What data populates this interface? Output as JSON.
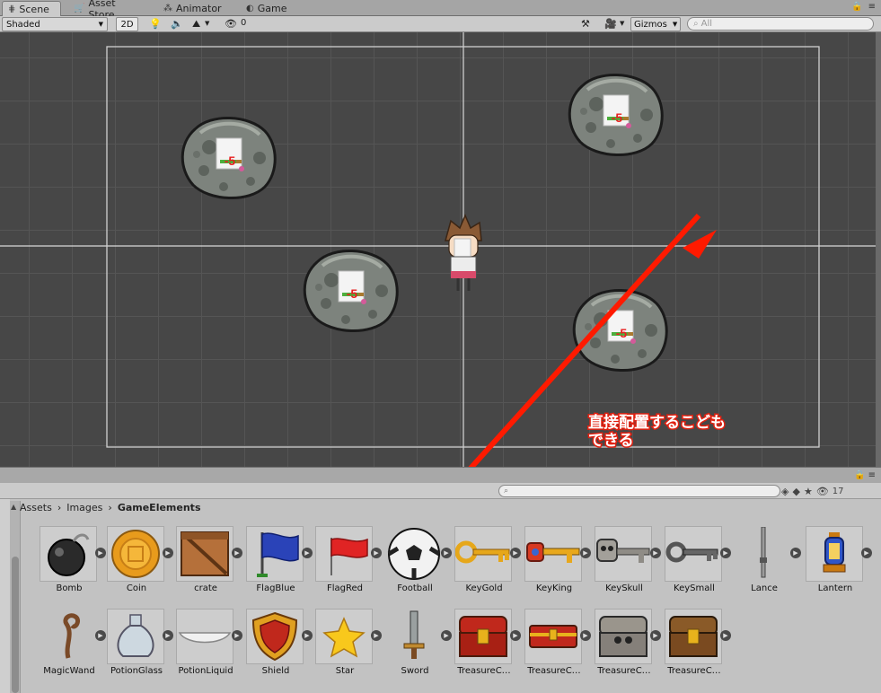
{
  "tabs": [
    {
      "label": "Scene",
      "icon": "grid-icon"
    },
    {
      "label": "Asset Store",
      "icon": "cart-icon"
    },
    {
      "label": "Animator",
      "icon": "animator-icon"
    },
    {
      "label": "Game",
      "icon": "pacman-icon"
    }
  ],
  "toolbar": {
    "shading_mode": "Shaded",
    "mode_2d": "2D",
    "hidden_count": "0",
    "gizmos": "Gizmos",
    "search_placeholder": "All"
  },
  "annotation": {
    "line1": "直接配置するこども",
    "line2": "できる",
    "arrow_color": "#ff1a00"
  },
  "project": {
    "breadcrumb": [
      "Assets",
      "Images",
      "GameElements"
    ],
    "filter_count": "17"
  },
  "assets": [
    {
      "label": "Bomb",
      "icon": "bomb-icon"
    },
    {
      "label": "Coin",
      "icon": "coin-icon"
    },
    {
      "label": "crate",
      "icon": "crate-icon"
    },
    {
      "label": "FlagBlue",
      "icon": "flag-blue-icon"
    },
    {
      "label": "FlagRed",
      "icon": "flag-red-icon"
    },
    {
      "label": "Football",
      "icon": "football-icon"
    },
    {
      "label": "KeyGold",
      "icon": "key-gold-icon"
    },
    {
      "label": "KeyKing",
      "icon": "key-king-icon"
    },
    {
      "label": "KeySkull",
      "icon": "key-skull-icon"
    },
    {
      "label": "KeySmall",
      "icon": "key-small-icon"
    },
    {
      "label": "Lance",
      "icon": "lance-icon"
    },
    {
      "label": "Lantern",
      "icon": "lantern-icon"
    },
    {
      "label": "MagicWand",
      "icon": "magic-wand-icon"
    },
    {
      "label": "PotionGlass",
      "icon": "potion-glass-icon"
    },
    {
      "label": "PotionLiquid",
      "icon": "potion-liquid-icon"
    },
    {
      "label": "Shield",
      "icon": "shield-icon"
    },
    {
      "label": "Star",
      "icon": "star-icon"
    },
    {
      "label": "Sword",
      "icon": "sword-icon"
    },
    {
      "label": "TreasureC…",
      "icon": "treasure-chest-icon"
    },
    {
      "label": "TreasureC…",
      "icon": "treasure-chest-icon"
    },
    {
      "label": "TreasureC…",
      "icon": "treasure-chest-icon"
    },
    {
      "label": "TreasureC…",
      "icon": "treasure-chest-icon"
    }
  ],
  "sprites": {
    "rock_badge": "-5"
  }
}
